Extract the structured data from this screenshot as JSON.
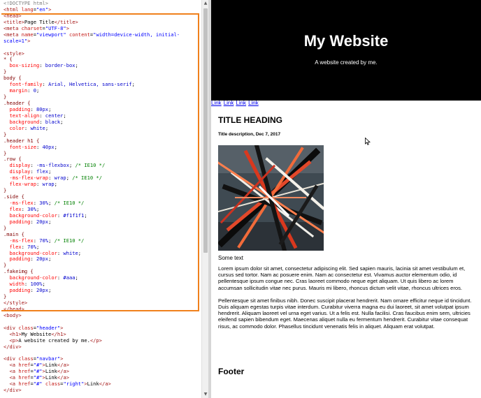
{
  "editor": {
    "lines": [
      [
        [
          "t-doc",
          "<!DOCTYPE html>"
        ]
      ],
      [
        [
          "t-tag",
          "<html "
        ],
        [
          "t-attr",
          "lang"
        ],
        [
          "",
          "="
        ],
        [
          "t-str",
          "\"en\""
        ],
        [
          "t-tag",
          ">"
        ]
      ],
      [
        [
          "t-tag",
          "<head>"
        ]
      ],
      [
        [
          "t-tag",
          "<title>"
        ],
        [
          "",
          "Page Title"
        ],
        [
          "t-tag",
          "</title>"
        ]
      ],
      [
        [
          "t-tag",
          "<meta "
        ],
        [
          "t-attr",
          "charset"
        ],
        [
          "",
          "="
        ],
        [
          "t-str",
          "\"UTF-8\""
        ],
        [
          "t-tag",
          ">"
        ]
      ],
      [
        [
          "t-tag",
          "<meta "
        ],
        [
          "t-attr",
          "name"
        ],
        [
          "",
          "="
        ],
        [
          "t-str",
          "\"viewport\""
        ],
        [
          "t-attr",
          " content"
        ],
        [
          "",
          "="
        ],
        [
          "t-str",
          "\"width=device-width, initial-"
        ]
      ],
      [
        [
          "t-str",
          "scale=1\""
        ],
        [
          "t-tag",
          ">"
        ]
      ],
      [
        [
          "",
          ""
        ]
      ],
      [
        [
          "t-tag",
          "<style>"
        ]
      ],
      [
        [
          "t-sel",
          "* {"
        ]
      ],
      [
        [
          "t-prop",
          "  box-sizing"
        ],
        [
          "",
          ": "
        ],
        [
          "t-val",
          "border-box"
        ],
        [
          "",
          ";"
        ]
      ],
      [
        [
          "t-sel",
          "}"
        ]
      ],
      [
        [
          "t-sel",
          "body {"
        ]
      ],
      [
        [
          "t-prop",
          "  font-family"
        ],
        [
          "",
          ": "
        ],
        [
          "t-val",
          "Arial, Helvetica, sans-serif"
        ],
        [
          "",
          ";"
        ]
      ],
      [
        [
          "t-prop",
          "  margin"
        ],
        [
          "",
          ": "
        ],
        [
          "t-val",
          "0"
        ],
        [
          "",
          ";"
        ]
      ],
      [
        [
          "t-sel",
          "}"
        ]
      ],
      [
        [
          "t-sel",
          ".header {"
        ]
      ],
      [
        [
          "t-prop",
          "  padding"
        ],
        [
          "",
          ": "
        ],
        [
          "t-val",
          "80px"
        ],
        [
          "",
          ";"
        ]
      ],
      [
        [
          "t-prop",
          "  text-align"
        ],
        [
          "",
          ": "
        ],
        [
          "t-val",
          "center"
        ],
        [
          "",
          ";"
        ]
      ],
      [
        [
          "t-prop",
          "  background"
        ],
        [
          "",
          ": "
        ],
        [
          "t-val",
          "black"
        ],
        [
          "",
          ";"
        ]
      ],
      [
        [
          "t-prop",
          "  color"
        ],
        [
          "",
          ": "
        ],
        [
          "t-val",
          "white"
        ],
        [
          "",
          ";"
        ]
      ],
      [
        [
          "t-sel",
          "}"
        ]
      ],
      [
        [
          "t-sel",
          ".header h1 {"
        ]
      ],
      [
        [
          "t-prop",
          "  font-size"
        ],
        [
          "",
          ": "
        ],
        [
          "t-val",
          "40px"
        ],
        [
          "",
          ";"
        ]
      ],
      [
        [
          "t-sel",
          "}"
        ]
      ],
      [
        [
          "t-sel",
          ".row {"
        ]
      ],
      [
        [
          "t-prop",
          "  display"
        ],
        [
          "",
          ": "
        ],
        [
          "t-val",
          "-ms-flexbox"
        ],
        [
          "",
          "; "
        ],
        [
          "t-com",
          "/* IE10 */"
        ]
      ],
      [
        [
          "t-prop",
          "  display"
        ],
        [
          "",
          ": "
        ],
        [
          "t-val",
          "flex"
        ],
        [
          "",
          ";"
        ]
      ],
      [
        [
          "t-prop",
          "  -ms-flex-wrap"
        ],
        [
          "",
          ": "
        ],
        [
          "t-val",
          "wrap"
        ],
        [
          "",
          "; "
        ],
        [
          "t-com",
          "/* IE10 */"
        ]
      ],
      [
        [
          "t-prop",
          "  flex-wrap"
        ],
        [
          "",
          ": "
        ],
        [
          "t-val",
          "wrap"
        ],
        [
          "",
          ";"
        ]
      ],
      [
        [
          "t-sel",
          "}"
        ]
      ],
      [
        [
          "t-sel",
          ".side {"
        ]
      ],
      [
        [
          "t-prop",
          "  -ms-flex"
        ],
        [
          "",
          ": "
        ],
        [
          "t-val",
          "30%"
        ],
        [
          "",
          "; "
        ],
        [
          "t-com",
          "/* IE10 */"
        ]
      ],
      [
        [
          "t-prop",
          "  flex"
        ],
        [
          "",
          ": "
        ],
        [
          "t-val",
          "30%"
        ],
        [
          "",
          ";"
        ]
      ],
      [
        [
          "t-prop",
          "  background-color"
        ],
        [
          "",
          ": "
        ],
        [
          "t-val",
          "#f1f1f1"
        ],
        [
          "",
          ";"
        ]
      ],
      [
        [
          "t-prop",
          "  padding"
        ],
        [
          "",
          ": "
        ],
        [
          "t-val",
          "20px"
        ],
        [
          "",
          ";"
        ]
      ],
      [
        [
          "t-sel",
          "}"
        ]
      ],
      [
        [
          "t-sel",
          ".main {"
        ]
      ],
      [
        [
          "t-prop",
          "  -ms-flex"
        ],
        [
          "",
          ": "
        ],
        [
          "t-val",
          "70%"
        ],
        [
          "",
          "; "
        ],
        [
          "t-com",
          "/* IE10 */"
        ]
      ],
      [
        [
          "t-prop",
          "  flex"
        ],
        [
          "",
          ": "
        ],
        [
          "t-val",
          "70%"
        ],
        [
          "",
          ";"
        ]
      ],
      [
        [
          "t-prop",
          "  background-color"
        ],
        [
          "",
          ": "
        ],
        [
          "t-val",
          "white"
        ],
        [
          "",
          ";"
        ]
      ],
      [
        [
          "t-prop",
          "  padding"
        ],
        [
          "",
          ": "
        ],
        [
          "t-val",
          "20px"
        ],
        [
          "",
          ";"
        ]
      ],
      [
        [
          "t-sel",
          "}"
        ]
      ],
      [
        [
          "t-sel",
          ".fakeimg {"
        ]
      ],
      [
        [
          "t-prop",
          "  background-color"
        ],
        [
          "",
          ": "
        ],
        [
          "t-val",
          "#aaa"
        ],
        [
          "",
          ";"
        ]
      ],
      [
        [
          "t-prop",
          "  width"
        ],
        [
          "",
          ": "
        ],
        [
          "t-val",
          "100%"
        ],
        [
          "",
          ";"
        ]
      ],
      [
        [
          "t-prop",
          "  padding"
        ],
        [
          "",
          ": "
        ],
        [
          "t-val",
          "20px"
        ],
        [
          "",
          ";"
        ]
      ],
      [
        [
          "t-sel",
          "}"
        ]
      ],
      [
        [
          "t-tag",
          "</style>"
        ]
      ],
      [
        [
          "t-tag",
          "</head>"
        ]
      ],
      [
        [
          "t-tag",
          "<body>"
        ]
      ],
      [
        [
          "",
          ""
        ]
      ],
      [
        [
          "t-tag",
          "<div "
        ],
        [
          "t-attr",
          "class"
        ],
        [
          "",
          "="
        ],
        [
          "t-str",
          "\"header\""
        ],
        [
          "t-tag",
          ">"
        ]
      ],
      [
        [
          "t-tag",
          "  <h1>"
        ],
        [
          "",
          "My Website"
        ],
        [
          "t-tag",
          "</h1>"
        ]
      ],
      [
        [
          "t-tag",
          "  <p>"
        ],
        [
          "",
          "A website created by me."
        ],
        [
          "t-tag",
          "</p>"
        ]
      ],
      [
        [
          "t-tag",
          "</div>"
        ]
      ],
      [
        [
          "",
          ""
        ]
      ],
      [
        [
          "t-tag",
          "<div "
        ],
        [
          "t-attr",
          "class"
        ],
        [
          "",
          "="
        ],
        [
          "t-str",
          "\"navbar\""
        ],
        [
          "t-tag",
          ">"
        ]
      ],
      [
        [
          "t-tag",
          "  <a "
        ],
        [
          "t-attr",
          "href"
        ],
        [
          "",
          "="
        ],
        [
          "t-str",
          "\"#\""
        ],
        [
          "t-tag",
          ">"
        ],
        [
          "",
          "Link"
        ],
        [
          "t-tag",
          "</a>"
        ]
      ],
      [
        [
          "t-tag",
          "  <a "
        ],
        [
          "t-attr",
          "href"
        ],
        [
          "",
          "="
        ],
        [
          "t-str",
          "\"#\""
        ],
        [
          "t-tag",
          ">"
        ],
        [
          "",
          "Link"
        ],
        [
          "t-tag",
          "</a>"
        ]
      ],
      [
        [
          "t-tag",
          "  <a "
        ],
        [
          "t-attr",
          "href"
        ],
        [
          "",
          "="
        ],
        [
          "t-str",
          "\"#\""
        ],
        [
          "t-tag",
          ">"
        ],
        [
          "",
          "Link"
        ],
        [
          "t-tag",
          "</a>"
        ]
      ],
      [
        [
          "t-tag",
          "  <a "
        ],
        [
          "t-attr",
          "href"
        ],
        [
          "",
          "="
        ],
        [
          "t-str",
          "\"#\""
        ],
        [
          "t-attr",
          " class"
        ],
        [
          "",
          "="
        ],
        [
          "t-str",
          "\"right\""
        ],
        [
          "t-tag",
          ">"
        ],
        [
          "",
          "Link"
        ],
        [
          "t-tag",
          "</a>"
        ]
      ],
      [
        [
          "t-tag",
          "</div>"
        ]
      ]
    ]
  },
  "preview": {
    "header": {
      "title": "My Website",
      "subtitle": "A website created by me."
    },
    "navbar": {
      "links": [
        "Link",
        "Link",
        "Link",
        "Link"
      ]
    },
    "main": {
      "heading": "TITLE HEADING",
      "description": "Title description, Dec 7, 2017",
      "caption": "Some text",
      "paragraph1": "Lorem ipsum dolor sit amet, consectetur adipiscing elit. Sed sapien mauris, lacinia sit amet vestibulum et, cursus sed tortor. Nam ac posuere enim. Nam ac consectetur est. Vivamus auctor elementum odio, id pellentesque ipsum congue nec. Cras laoreet commodo neque eget aliquam. Ut quis libero ac lorem accumsan sollicitudin vitae nec purus. Mauris mi libero, rhoncus dictum velit vitae, rhoncus ultrices eros.",
      "paragraph2": "Pellentesque sit amet finibus nibh. Donec suscipit placerat hendrerit. Nam ornare efficitur neque id tincidunt. Duis aliquam egestas turpis vitae interdum. Curabitur viverra magna eu dui laoreet, sit amet volutpat ipsum hendrerit. Aliquam laoreet vel urna eget varius. Ut a felis est. Nulla facilisi. Cras faucibus enim sem, ultricies eleifend sapien bibendum eget. Maecenas aliquet nulla eu fermentum hendrerit. Curabitur vitae consequat risus, ac commodo dolor. Phasellus tincidunt venenatis felis in aliquet. Aliquam erat volutpat."
    },
    "footer": {
      "title": "Footer"
    }
  },
  "colors": {
    "highlight_frame": "#f0801c",
    "header_bg": "#000000",
    "link": "#0000ee"
  }
}
